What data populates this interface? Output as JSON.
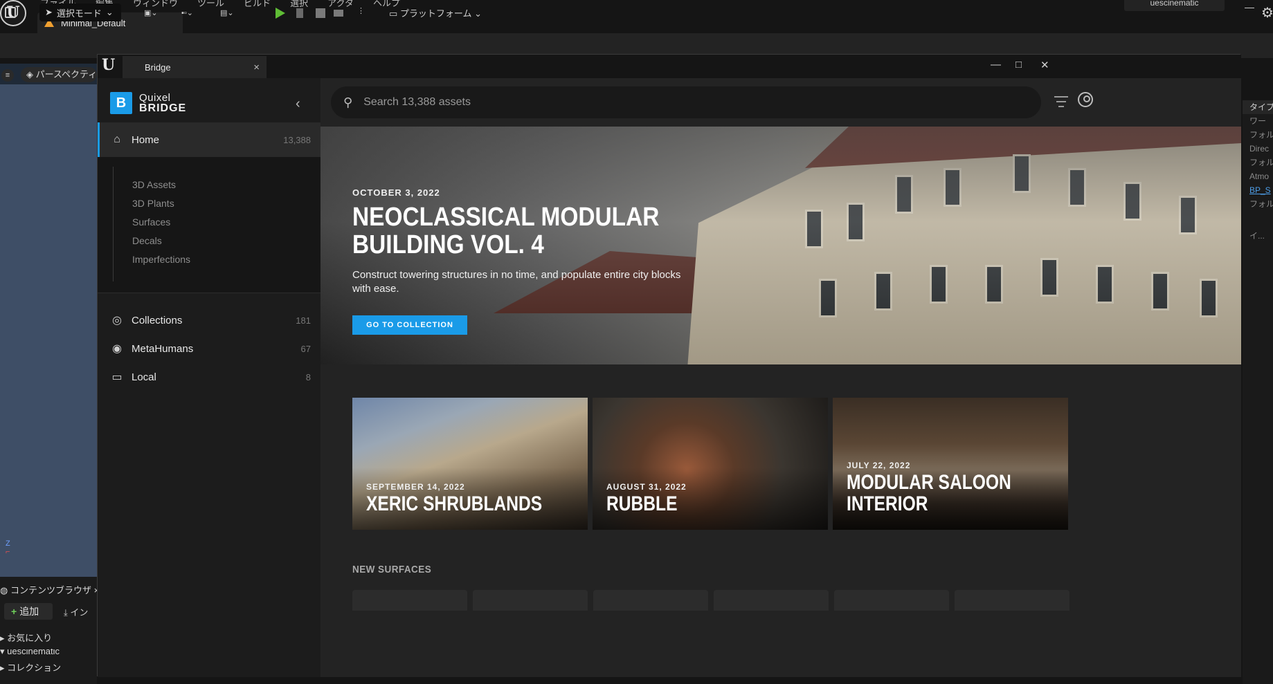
{
  "editor": {
    "menu": [
      "ファイル",
      "編集",
      "ウィンドウ",
      "ツール",
      "ビルド",
      "選択",
      "アクタ",
      "ヘルプ"
    ],
    "level_tab": "Minimal_Default",
    "user": "uescinematic",
    "mode_label": "選択モード",
    "platform_label": "プラットフォーム",
    "viewport_label": "パースペクティ",
    "content_browser_tab": "コンテンツブラウザ",
    "add_label": "追加",
    "import_label": "イン",
    "favorites_label": "お気に入り",
    "project_label": "uescinematic",
    "collections_label": "コレクション",
    "right_panel": {
      "header": "タイプ",
      "items": [
        "ワー",
        "フォル",
        "Direc",
        "フォル",
        "Atmo",
        "BP_S",
        "フォル"
      ],
      "footer": "イ..."
    }
  },
  "bridge": {
    "tab_title": "Bridge",
    "brand_top": "Quixel",
    "brand_bottom": "BRIDGE",
    "nav": {
      "home": {
        "label": "Home",
        "count": "13,388"
      },
      "sub_items": [
        "3D Assets",
        "3D Plants",
        "Surfaces",
        "Decals",
        "Imperfections"
      ],
      "collections": {
        "label": "Collections",
        "count": "181"
      },
      "metahumans": {
        "label": "MetaHumans",
        "count": "67"
      },
      "local": {
        "label": "Local",
        "count": "8"
      }
    },
    "search": {
      "placeholder": "Search 13,388 assets"
    },
    "hero": {
      "date": "OCTOBER 3, 2022",
      "title": "NEOCLASSICAL MODULAR BUILDING VOL. 4",
      "description": "Construct towering structures in no time, and populate entire city blocks with ease.",
      "button": "GO TO COLLECTION"
    },
    "cards": [
      {
        "date": "SEPTEMBER 14, 2022",
        "title": "XERIC SHRUBLANDS"
      },
      {
        "date": "AUGUST 31, 2022",
        "title": "RUBBLE"
      },
      {
        "date": "JULY 22, 2022",
        "title": "MODULAR SALOON INTERIOR"
      }
    ],
    "section_title": "NEW SURFACES",
    "accent_color": "#1a9be8"
  }
}
